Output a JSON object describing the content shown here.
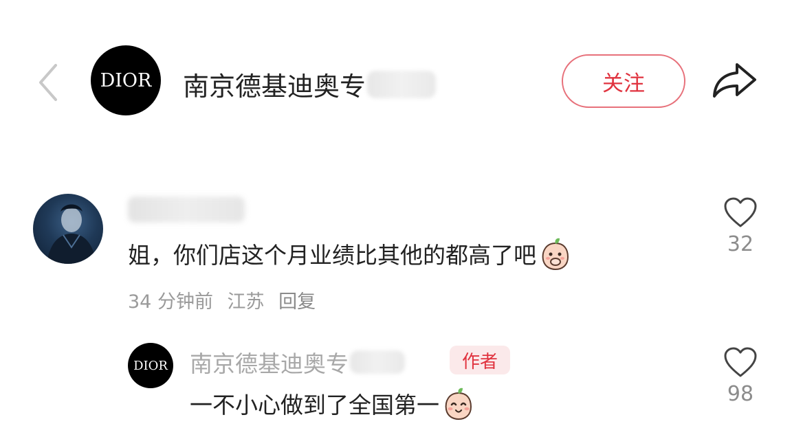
{
  "header": {
    "back_icon": "chevron-left-icon",
    "avatar_text": "DIOR",
    "title": "南京德基迪奥专",
    "follow_label": "关注",
    "share_icon": "share-arrow-icon"
  },
  "comment": {
    "avatar_icon": "user-photo-avatar",
    "text": "姐，你们店这个月业绩比其他的都高了吧",
    "emoji_icon": "peach-covering-mouth-emoji",
    "time": "34 分钟前",
    "location": "江苏",
    "reply_label": "回复",
    "like_icon": "heart-outline-icon",
    "like_count": "32"
  },
  "reply": {
    "avatar_text": "DIOR",
    "name": "南京德基迪奥专",
    "author_tag": "作者",
    "text": "一不小心做到了全国第一",
    "emoji_icon": "peach-smile-emoji",
    "like_icon": "heart-outline-icon",
    "like_count": "98"
  },
  "colors": {
    "accent": "#e0333f",
    "follow_border": "#e7707a",
    "meta_gray": "#9a9a9a",
    "author_tag_bg": "#fbe9ea"
  }
}
